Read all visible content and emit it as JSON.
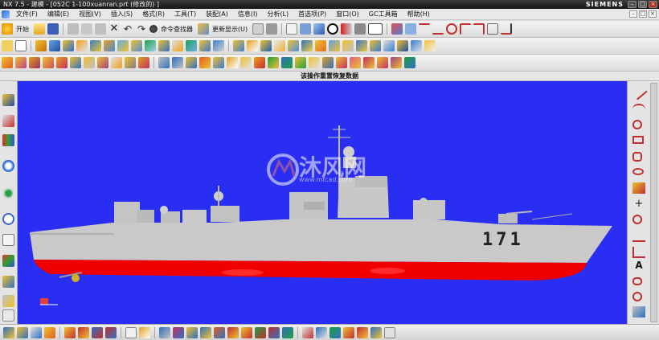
{
  "window": {
    "title": "NX 7.5 - 建模 - [052C   1-100xuanran.prt  (修改的) ]",
    "brand": "SIEMENS",
    "controls": [
      "–",
      "□",
      "×"
    ]
  },
  "menubar": {
    "items": [
      "文件(F)",
      "编辑(E)",
      "视图(V)",
      "插入(S)",
      "格式(R)",
      "工具(T)",
      "装配(A)",
      "信息(I)",
      "分析(L)",
      "首选项(P)",
      "窗口(O)",
      "GC工具箱",
      "帮助(H)"
    ],
    "window_controls": [
      "–",
      "□",
      "×"
    ]
  },
  "toolbar1": {
    "start_label": "开始",
    "command_finder_label": "命令查找器",
    "update_display_label": "更新显示(U)"
  },
  "statusline": {
    "message": "该操作重置恢复数据"
  },
  "viewport": {
    "background": "#2a2ef2",
    "watermark_cn": "沐风网",
    "watermark_url": "www.mfcad.com",
    "hull_number": "171"
  },
  "colors": {
    "hull_gray": "#c9c9c9",
    "hull_red": "#f00000",
    "viewport_blue": "#2a2ef2"
  },
  "icons": {
    "left": [
      "part-navigator-icon",
      "assembly-navigator-icon",
      "constraint-navigator-icon",
      "history-icon",
      "roles-icon",
      "web-browser-icon",
      "clock-icon",
      "reuse-library-icon",
      "visualization-icon",
      "palette-icon",
      "system-materials-icon"
    ],
    "right": [
      "line-icon",
      "arc-icon",
      "circle-icon",
      "rectangle-icon",
      "polygon-icon",
      "ellipse-icon",
      "spline-icon",
      "point-icon",
      "offset-curve-icon",
      "text-icon",
      "helix-icon",
      "fillet-icon"
    ]
  }
}
